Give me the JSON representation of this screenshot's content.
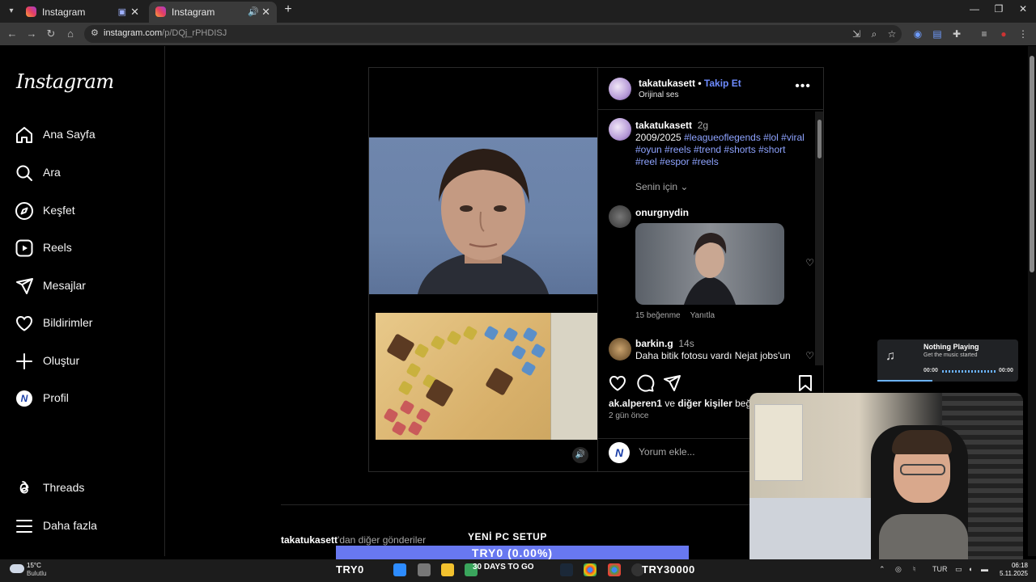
{
  "browser": {
    "tabs": [
      {
        "title": "Instagram",
        "active": false
      },
      {
        "title": "Instagram",
        "active": true
      }
    ],
    "url_host": "instagram.com",
    "url_path": "/p/DQj_rPHDISJ"
  },
  "sidebar": {
    "logo": "Instagram",
    "items": [
      {
        "label": "Ana Sayfa",
        "icon": "home-icon"
      },
      {
        "label": "Ara",
        "icon": "search-icon"
      },
      {
        "label": "Keşfet",
        "icon": "compass-icon"
      },
      {
        "label": "Reels",
        "icon": "reels-icon"
      },
      {
        "label": "Mesajlar",
        "icon": "send-icon"
      },
      {
        "label": "Bildirimler",
        "icon": "heart-icon"
      },
      {
        "label": "Oluştur",
        "icon": "plus-icon"
      },
      {
        "label": "Profil",
        "icon": "avatar"
      },
      {
        "label": "Threads",
        "icon": "threads-icon"
      },
      {
        "label": "Daha fazla",
        "icon": "menu-icon"
      }
    ]
  },
  "post": {
    "header": {
      "username": "takatukasett",
      "separator": " • ",
      "follow": "Takip Et",
      "audio": "Orijinal ses"
    },
    "caption": {
      "username": "takatukasett",
      "time": "2g",
      "text_plain": "2009/2025 ",
      "hashtags": "#leagueoflegends #lol #viral #oyun #reels #trend #shorts #short #reel #espor #reels"
    },
    "for_you": "Senin için",
    "comments": [
      {
        "username": "onurgnydin",
        "likes": "15 beğenme",
        "reply": "Yanıtla"
      },
      {
        "username": "barkin.g",
        "time": "14s",
        "text": "Daha bitik fotosu vardı Nejat jobs'un"
      }
    ],
    "liked_by_user": "ak.alperen1",
    "liked_by_mid": " ve ",
    "liked_by_others": "diğer kişiler",
    "liked_by_end": " beğendi",
    "ago": "2 gün önce",
    "comment_placeholder": "Yorum ekle..."
  },
  "more_posts": {
    "user": "takatukasett",
    "suffix": "'dan diğer gönderiler"
  },
  "overlay": {
    "music_title": "Nothing Playing",
    "music_sub": "Get the music started",
    "music_time_start": "00:00",
    "music_time_end": "00:00",
    "stream_title": "YENİ PC SETUP",
    "ticker": "TRY0 (0.00%)"
  },
  "taskbar": {
    "weather_temp": "15°C",
    "weather_desc": "Bulutlu",
    "left_label": "TRY0",
    "goal_text": "30 DAYS TO GO",
    "right_label": "TRY30000",
    "lang": "TUR",
    "time": "06:18",
    "date": "5.11.2025"
  },
  "colors": {
    "accent_link": "#6e8cff",
    "hashtag": "#8ea3ff",
    "ticker_bg": "#6878f0"
  }
}
